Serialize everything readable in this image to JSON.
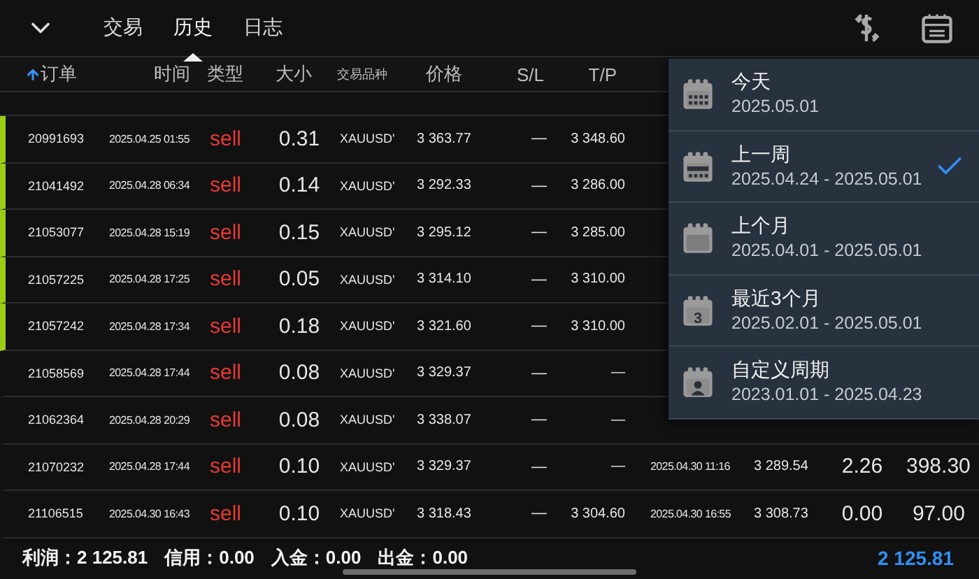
{
  "tabs": [
    {
      "label": "交易",
      "selected": false
    },
    {
      "label": "历史",
      "selected": true
    },
    {
      "label": "日志",
      "selected": false
    }
  ],
  "columns": [
    {
      "label": "订单",
      "sorted": true
    },
    {
      "label": "时间",
      "sorted": false
    },
    {
      "label": "类型",
      "sorted": false
    },
    {
      "label": "大小",
      "sorted": false
    },
    {
      "label": "交易品种",
      "sorted": false
    },
    {
      "label": "价格",
      "sorted": false
    },
    {
      "label": "S/L",
      "sorted": false
    },
    {
      "label": "T/P",
      "sorted": false
    }
  ],
  "rows": [
    {
      "order": "20991693",
      "time": "2025.04.25 01:55",
      "type": "sell",
      "size": "0.31",
      "symbol": "XAUUSD'",
      "price": "3 363.77",
      "sl": "—",
      "tp": "3 348.60",
      "flagged": true
    },
    {
      "order": "21041492",
      "time": "2025.04.28 06:34",
      "type": "sell",
      "size": "0.14",
      "symbol": "XAUUSD'",
      "price": "3 292.33",
      "sl": "—",
      "tp": "3 286.00",
      "flagged": true
    },
    {
      "order": "21053077",
      "time": "2025.04.28 15:19",
      "type": "sell",
      "size": "0.15",
      "symbol": "XAUUSD'",
      "price": "3 295.12",
      "sl": "—",
      "tp": "3 285.00",
      "flagged": true
    },
    {
      "order": "21057225",
      "time": "2025.04.28 17:25",
      "type": "sell",
      "size": "0.05",
      "symbol": "XAUUSD'",
      "price": "3 314.10",
      "sl": "—",
      "tp": "3 310.00",
      "flagged": true
    },
    {
      "order": "21057242",
      "time": "2025.04.28 17:34",
      "type": "sell",
      "size": "0.18",
      "symbol": "XAUUSD'",
      "price": "3 321.60",
      "sl": "—",
      "tp": "3 310.00",
      "flagged": true
    },
    {
      "order": "21058569",
      "time": "2025.04.28 17:44",
      "type": "sell",
      "size": "0.08",
      "symbol": "XAUUSD'",
      "price": "3 329.37",
      "sl": "—",
      "tp": "—",
      "flagged": false
    },
    {
      "order": "21062364",
      "time": "2025.04.28 20:29",
      "type": "sell",
      "size": "0.08",
      "symbol": "XAUUSD'",
      "price": "3 338.07",
      "sl": "—",
      "tp": "—",
      "flagged": false
    },
    {
      "order": "21070232",
      "time": "2025.04.28 17:44",
      "type": "sell",
      "size": "0.10",
      "symbol": "XAUUSD'",
      "price": "3 329.37",
      "sl": "—",
      "tp": "—",
      "close_time": "2025.04.30 11:16",
      "close_price": "3 289.54",
      "swap": "2.26",
      "profit": "398.30",
      "flagged": false
    },
    {
      "order": "21106515",
      "time": "2025.04.30 16:43",
      "type": "sell",
      "size": "0.10",
      "symbol": "XAUUSD'",
      "price": "3 318.43",
      "sl": "—",
      "tp": "3 304.60",
      "close_time": "2025.04.30 16:55",
      "close_price": "3 308.73",
      "swap": "0.00",
      "profit": "97.00",
      "flagged": false
    }
  ],
  "period_menu": [
    {
      "kind": "today",
      "title": "今天",
      "range": "2025.05.01",
      "selected": false
    },
    {
      "kind": "week",
      "title": "上一周",
      "range": "2025.04.24 - 2025.05.01",
      "selected": true
    },
    {
      "kind": "month",
      "title": "上个月",
      "range": "2025.04.01 - 2025.05.01",
      "selected": false
    },
    {
      "kind": "number",
      "title": "最近3个月",
      "range": "2025.02.01 - 2025.05.01",
      "icon_text": "3",
      "selected": false
    },
    {
      "kind": "custom",
      "title": "自定义周期",
      "range": "2023.01.01 - 2025.04.23",
      "selected": false
    }
  ],
  "footer": {
    "items": [
      "利润：2 125.81",
      "信用：0.00",
      "入金：0.00",
      "出金：0.00"
    ],
    "total": "2 125.81"
  }
}
